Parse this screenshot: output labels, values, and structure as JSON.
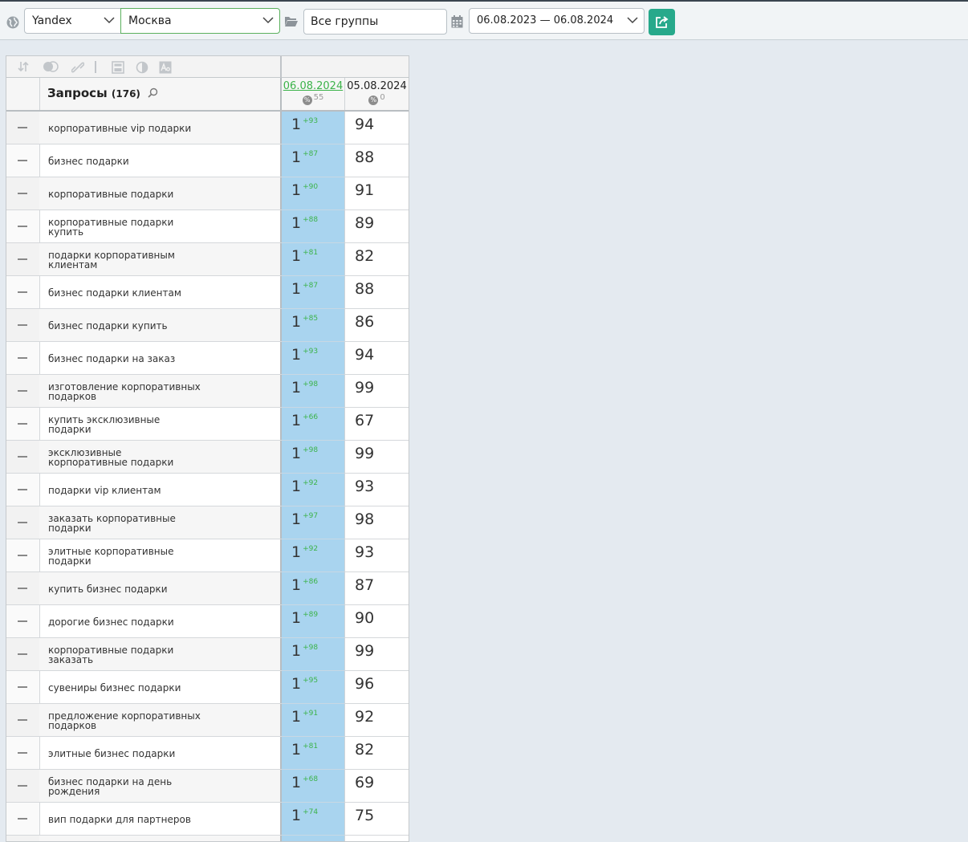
{
  "toolbar": {
    "engine": "Yandex",
    "city": "Москва",
    "group": "Все группы",
    "date_range": "06.08.2023 — 06.08.2024"
  },
  "table": {
    "query_header": "Запросы",
    "query_count": "(176)",
    "columns": [
      {
        "date": "06.08.2024",
        "pct": "55"
      },
      {
        "date": "05.08.2024",
        "pct": "0"
      }
    ],
    "rows": [
      {
        "query": "корпоративные vip подарки",
        "pos": "1",
        "delta": "+93",
        "prev": "94"
      },
      {
        "query": "бизнес подарки",
        "pos": "1",
        "delta": "+87",
        "prev": "88"
      },
      {
        "query": "корпоративные подарки",
        "pos": "1",
        "delta": "+90",
        "prev": "91"
      },
      {
        "query": "корпоративные подарки купить",
        "pos": "1",
        "delta": "+88",
        "prev": "89"
      },
      {
        "query": "подарки корпоративным клиентам",
        "pos": "1",
        "delta": "+81",
        "prev": "82"
      },
      {
        "query": "бизнес подарки клиентам",
        "pos": "1",
        "delta": "+87",
        "prev": "88"
      },
      {
        "query": "бизнес подарки купить",
        "pos": "1",
        "delta": "+85",
        "prev": "86"
      },
      {
        "query": "бизнес подарки на заказ",
        "pos": "1",
        "delta": "+93",
        "prev": "94"
      },
      {
        "query": "изготовление корпоративных подарков",
        "pos": "1",
        "delta": "+98",
        "prev": "99"
      },
      {
        "query": "купить эксклюзивные подарки",
        "pos": "1",
        "delta": "+66",
        "prev": "67"
      },
      {
        "query": "эксклюзивные корпоративные подарки",
        "pos": "1",
        "delta": "+98",
        "prev": "99"
      },
      {
        "query": "подарки vip клиентам",
        "pos": "1",
        "delta": "+92",
        "prev": "93"
      },
      {
        "query": "заказать корпоративные подарки",
        "pos": "1",
        "delta": "+97",
        "prev": "98"
      },
      {
        "query": "элитные корпоративные подарки",
        "pos": "1",
        "delta": "+92",
        "prev": "93"
      },
      {
        "query": "купить бизнес подарки",
        "pos": "1",
        "delta": "+86",
        "prev": "87"
      },
      {
        "query": "дорогие бизнес подарки",
        "pos": "1",
        "delta": "+89",
        "prev": "90"
      },
      {
        "query": "корпоративные подарки заказать",
        "pos": "1",
        "delta": "+98",
        "prev": "99"
      },
      {
        "query": "сувениры бизнес подарки",
        "pos": "1",
        "delta": "+95",
        "prev": "96"
      },
      {
        "query": "предложение корпоративных подарков",
        "pos": "1",
        "delta": "+91",
        "prev": "92"
      },
      {
        "query": "элитные бизнес подарки",
        "pos": "1",
        "delta": "+81",
        "prev": "82"
      },
      {
        "query": "бизнес подарки на день рождения",
        "pos": "1",
        "delta": "+68",
        "prev": "69"
      },
      {
        "query": "вип подарки для партнеров",
        "pos": "1",
        "delta": "+74",
        "prev": "75"
      },
      {
        "query": "",
        "pos": "",
        "delta": "",
        "prev": ""
      }
    ]
  }
}
